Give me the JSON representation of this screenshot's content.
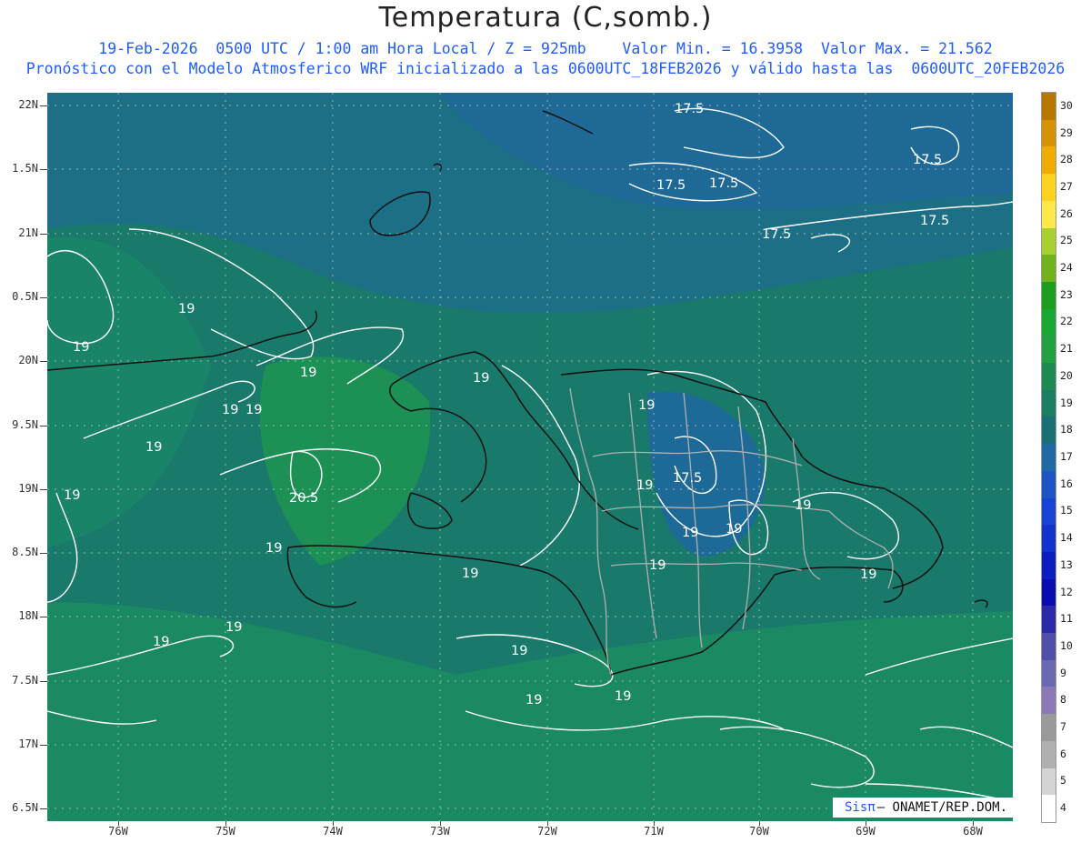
{
  "header": {
    "title": "Temperatura (C,somb.)",
    "line1": "19-Feb-2026  0500 UTC / 1:00 am Hora Local / Z = 925mb    Valor Min. = 16.3958  Valor Max. = 21.562",
    "line2": "Pronóstico con el Modelo Atmosferico WRF inicializado a las 0600UTC_18FEB2026 y válido hasta las  0600UTC_20FEB2026"
  },
  "axes": {
    "lat_labels": [
      "22N",
      "1.5N",
      "21N",
      "0.5N",
      "20N",
      "9.5N",
      "19N",
      "8.5N",
      "18N",
      "7.5N",
      "17N",
      "6.5N"
    ],
    "lon_labels": [
      "76W",
      "75W",
      "74W",
      "73W",
      "72W",
      "71W",
      "70W",
      "69W",
      "68W"
    ]
  },
  "colorbar": {
    "levels": [
      "30",
      "29",
      "28",
      "27",
      "26",
      "25",
      "24",
      "23",
      "22",
      "21",
      "20",
      "19",
      "18",
      "17",
      "16",
      "15",
      "14",
      "13",
      "12",
      "11",
      "10",
      "9",
      "8",
      "7",
      "6",
      "5",
      "4"
    ],
    "colors": [
      "#b87800",
      "#d69200",
      "#f0ac00",
      "#ffd21e",
      "#ffe94a",
      "#a8d030",
      "#72b21e",
      "#1e9e1e",
      "#1aa832",
      "#22a042",
      "#1c8a52",
      "#1a7e62",
      "#1a7074",
      "#1f6aa4",
      "#1d56c4",
      "#1844d6",
      "#1232cc",
      "#0c1ec0",
      "#0a0cb0",
      "#2a2aa8",
      "#5050aa",
      "#6a6ab0",
      "#8a78b8",
      "#9a9a9a",
      "#b0b0b0",
      "#d4d4d4",
      "#ffffff"
    ]
  },
  "contour_labels": [
    "17.5",
    "17.5",
    "17.5",
    "17.5",
    "17.5",
    "17.5",
    "17.5",
    "19",
    "19",
    "19",
    "19",
    "19",
    "19",
    "19",
    "19",
    "19",
    "19",
    "19",
    "19",
    "19",
    "19",
    "19",
    "19",
    "19",
    "19",
    "19",
    "19",
    "19",
    "19",
    "20.5"
  ],
  "credit": {
    "logo": "Sisπ",
    "text": "– ONAMET/REP.DOM."
  }
}
